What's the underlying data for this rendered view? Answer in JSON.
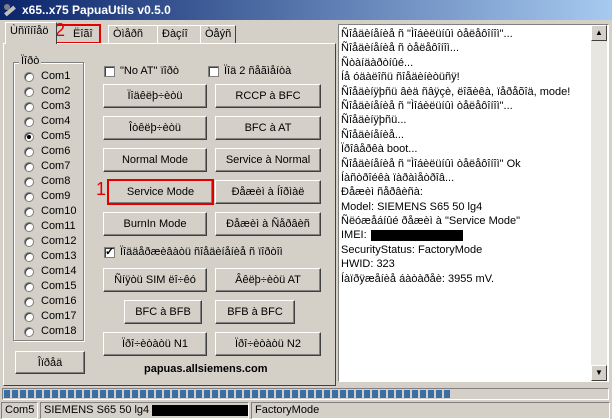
{
  "window": {
    "title": "x65..x75 PapuaUtils v0.5.0"
  },
  "tabs": [
    {
      "label": "Ùñïîíîåö"
    },
    {
      "label": "Ëîãî"
    },
    {
      "label": "Òìåðñ"
    },
    {
      "label": "Ðàçíî"
    },
    {
      "label": "Òåýñ"
    }
  ],
  "com_group": {
    "title": "Ïîðò",
    "ports": [
      "Com1",
      "Com2",
      "Com3",
      "Com4",
      "Com5",
      "Com6",
      "Com7",
      "Com8",
      "Com9",
      "Com10",
      "Com11",
      "Com12",
      "Com13",
      "Com14",
      "Com15",
      "Com16",
      "Com17",
      "Com18"
    ],
    "selected": "Com5"
  },
  "detect_button": {
    "label": "Îïðåä"
  },
  "checkboxes": {
    "no_at": {
      "label": "\"No AT\" ïîðò",
      "checked": false
    },
    "two_partition": {
      "label": "Ïîä 2 ñåãìåíòà",
      "checked": false
    },
    "keep_connection": {
      "label": "Ïîääåðæèâàòü ñîåäèíåíèå ñ ïîðòîì",
      "checked": true
    }
  },
  "buttons": {
    "connect": "Ïîäêëþ÷èòü",
    "rccp_bfc": "RCCP à BFC",
    "disconnect": "Îòêëþ÷èòü",
    "bfc_at": "BFC à AT",
    "normal_mode": "Normal Mode",
    "service_normal": "Service à Normal",
    "service_mode": "Service Mode",
    "reset_normal": "Ðåæèì à Íîðìàë",
    "burnin_mode": "BurnIn Mode",
    "reset_service": "Ðåæèì à Ñåðâèñ",
    "write_sim": "Ñíÿòü SIM ëî÷êó",
    "enable_at": "Âêëþ÷èòü AT",
    "bfc_bfb": "BFC à BFB",
    "bfb_bfc": "BFB à BFC",
    "read_n1": "Ïðî÷èòàòü N1",
    "read_n2": "Ïðî÷èòàòü N2"
  },
  "footer_link": "papuas.allsiemens.com",
  "annotations": {
    "one": "1",
    "two": "2"
  },
  "log": {
    "lines": [
      "Ñîåäèíåíèå ñ \"Ìîáèëüíûì òåëåôîíîì\"...",
      "Ñîåäèíåíèå ñ òåëåôîíîì...",
      "Ñòàíäàðòíûé...",
      "Íå óäàëîñü ñîåäèíèòüñÿ!",
      "Ñîåäèíÿþñü âèä ñâÿçè, ëîãèêà, ïåðåõîä, mode!",
      "Ñîåäèíåíèå ñ \"Ìîáèëüíûì òåëåôîíîì\"...",
      "Ñîåäèíÿþñü...",
      "Ñîåäèíåíèå...",
      "Ïðîâåðêà boot...",
      "Ñîåäèíåíèå ñ \"Ìîáèëüíûì òåëåôîíîì\" Ok",
      "Íàñòðîéêà ïàðàìåòðîâ...",
      "Ðåæèì ñåðâèñà:",
      "Model: SIEMENS S65 50 lg4",
      "Ñëóæåáíûé ðåæèì à \"Service Mode\"",
      "IMEI:",
      "SecurityStatus: FactoryMode",
      "HWID: 323",
      "Íàïðÿæåíèå áàòàðåè: 3955 mV."
    ]
  },
  "progress": {
    "fraction": 0.74
  },
  "statusbar": {
    "port": "Com5",
    "model": "SIEMENS S65 50 lg4",
    "mode": "FactoryMode"
  }
}
